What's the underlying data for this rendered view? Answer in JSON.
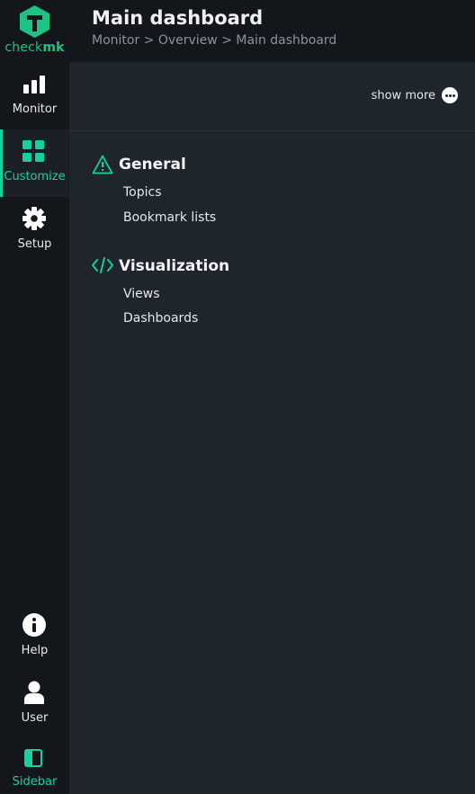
{
  "app": {
    "logo_text_light": "check",
    "logo_text_bold": "mk",
    "brand_color": "#15d1a0"
  },
  "nav": {
    "items": [
      {
        "label": "Monitor",
        "icon": "bar-chart-icon"
      },
      {
        "label": "Customize",
        "icon": "grid-icon",
        "active": true
      },
      {
        "label": "Setup",
        "icon": "gear-icon"
      }
    ],
    "bottom_items": [
      {
        "label": "Help",
        "icon": "info-icon"
      },
      {
        "label": "User",
        "icon": "user-icon"
      },
      {
        "label": "Sidebar",
        "icon": "sidebar-icon"
      }
    ]
  },
  "header": {
    "title": "Main dashboard",
    "breadcrumb": "Monitor > Overview > Main dashboard"
  },
  "toolbar": {
    "show_more_label": "show more"
  },
  "sections": [
    {
      "title": "General",
      "icon": "warning-icon",
      "links": [
        "Topics",
        "Bookmark lists"
      ]
    },
    {
      "title": "Visualization",
      "icon": "code-icon",
      "links": [
        "Views",
        "Dashboards"
      ]
    }
  ]
}
